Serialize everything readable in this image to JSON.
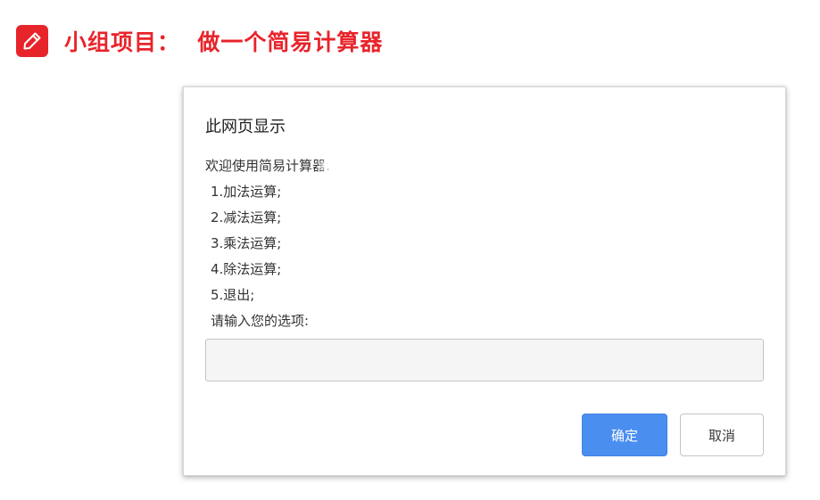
{
  "header": {
    "icon": "pencil-icon",
    "title": "小组项目：  做一个简易计算器",
    "accent_color": "#e8242b"
  },
  "dialog": {
    "title": "此网页显示",
    "message_lines": [
      "欢迎使用简易计算器:",
      "1.加法运算;",
      "2.减法运算;",
      "3.乘法运算;",
      "4.除法运算;",
      "5.退出;",
      "请输入您的选项:"
    ],
    "input_value": "",
    "ok_label": "确定",
    "cancel_label": "取消",
    "ok_color": "#4a8ef0"
  }
}
